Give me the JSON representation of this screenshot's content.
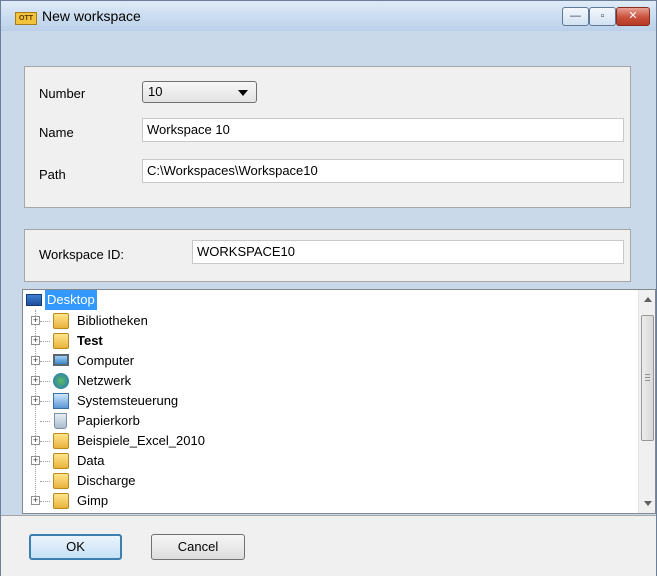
{
  "window": {
    "title": "New workspace",
    "icon": "OTT"
  },
  "titlebar_buttons": {
    "minimize": "—",
    "maximize": "▫",
    "close": "✕"
  },
  "form": {
    "number_label": "Number",
    "number_value": "10",
    "name_label": "Name",
    "name_value": "Workspace 10",
    "path_label": "Path",
    "path_value": "C:\\Workspaces\\Workspace10"
  },
  "workspace": {
    "id_label": "Workspace ID:",
    "id_value": "WORKSPACE10"
  },
  "tree": {
    "root": "Desktop",
    "items": [
      {
        "label": "Bibliotheken",
        "icon": "library-icon",
        "expandable": true
      },
      {
        "label": "Test",
        "icon": "user-folder-icon",
        "expandable": true
      },
      {
        "label": "Computer",
        "icon": "computer-icon",
        "expandable": true
      },
      {
        "label": "Netzwerk",
        "icon": "network-icon",
        "expandable": true
      },
      {
        "label": "Systemsteuerung",
        "icon": "control-panel-icon",
        "expandable": true
      },
      {
        "label": "Papierkorb",
        "icon": "recycle-bin-icon",
        "expandable": false
      },
      {
        "label": "Beispiele_Excel_2010",
        "icon": "folder-icon",
        "expandable": true
      },
      {
        "label": "Data",
        "icon": "folder-icon",
        "expandable": true
      },
      {
        "label": "Discharge",
        "icon": "folder-icon",
        "expandable": false
      },
      {
        "label": "Gimp",
        "icon": "folder-icon",
        "expandable": true
      }
    ]
  },
  "buttons": {
    "ok": "OK",
    "cancel": "Cancel"
  },
  "colors": {
    "selection": "#3399ff",
    "window_frame": "#c9d9ea",
    "panel": "#f0f0f0"
  }
}
